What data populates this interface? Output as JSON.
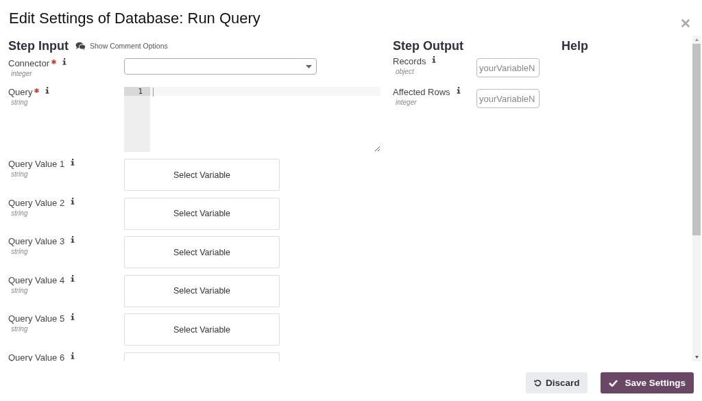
{
  "title": "Edit Settings of Database: Run Query",
  "step_input": {
    "heading": "Step Input",
    "comment_toggle": "Show Comment Options",
    "fields": [
      {
        "label": "Connector",
        "required": true,
        "type": "integer",
        "kind": "select"
      },
      {
        "label": "Query",
        "required": true,
        "type": "string",
        "kind": "code",
        "line_number": "1"
      },
      {
        "label": "Query Value 1",
        "required": false,
        "type": "string",
        "kind": "variable",
        "button": "Select Variable"
      },
      {
        "label": "Query Value 2",
        "required": false,
        "type": "string",
        "kind": "variable",
        "button": "Select Variable"
      },
      {
        "label": "Query Value 3",
        "required": false,
        "type": "string",
        "kind": "variable",
        "button": "Select Variable"
      },
      {
        "label": "Query Value 4",
        "required": false,
        "type": "string",
        "kind": "variable",
        "button": "Select Variable"
      },
      {
        "label": "Query Value 5",
        "required": false,
        "type": "string",
        "kind": "variable",
        "button": "Select Variable"
      },
      {
        "label": "Query Value 6",
        "required": false,
        "kind": "variable"
      }
    ]
  },
  "step_output": {
    "heading": "Step Output",
    "fields": [
      {
        "label": "Records",
        "type": "object",
        "placeholder": "yourVariableN"
      },
      {
        "label": "Affected Rows",
        "type": "integer",
        "placeholder": "yourVariableN"
      }
    ]
  },
  "help": {
    "heading": "Help"
  },
  "buttons": [
    {
      "label": "Discard",
      "kind": "secondary"
    },
    {
      "label": "Save Settings",
      "kind": "primary"
    }
  ]
}
